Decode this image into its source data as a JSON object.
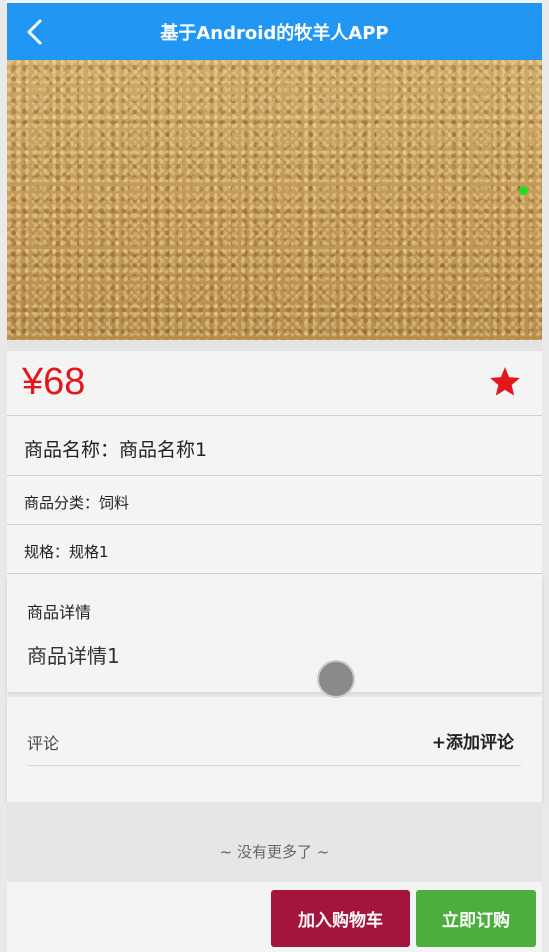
{
  "header": {
    "title": "基于Android的牧羊人APP"
  },
  "product": {
    "price": "¥68",
    "name_line": "商品名称：商品名称1",
    "category_line": "商品分类：饲料",
    "spec_line": "规格：规格1",
    "detail_heading": "商品详情",
    "detail_body": "商品详情1"
  },
  "comments": {
    "label": "评论",
    "add_label": "+添加评论"
  },
  "list_end_text": "~ 没有更多了 ~",
  "actions": {
    "add_to_cart": "加入购物车",
    "order_now": "立即订购"
  },
  "colors": {
    "header": "#2196f3",
    "price": "#e3161c",
    "cart_button": "#a3153a",
    "buy_button": "#4caf3d"
  },
  "icons": {
    "back": "chevron-left-icon",
    "favorite": "star-icon"
  }
}
